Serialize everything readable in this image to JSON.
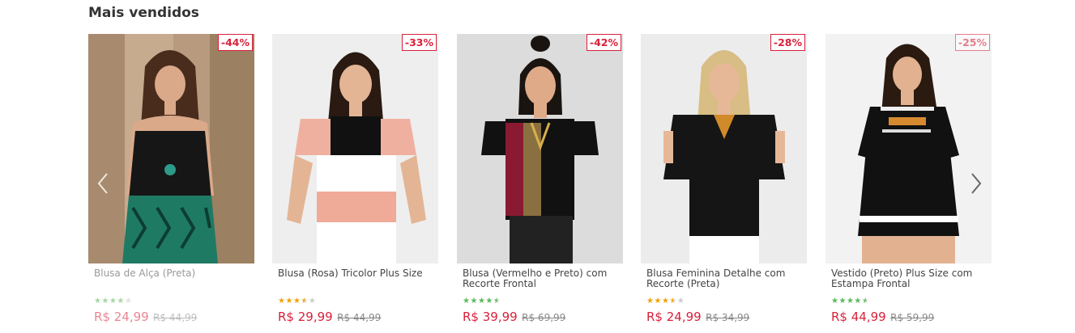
{
  "section": {
    "title": "Mais vendidos"
  },
  "nav": {
    "prev_icon": "chevron-left-icon",
    "next_icon": "chevron-right-icon"
  },
  "colors": {
    "accent": "#d9213a",
    "star_green": "#5cb85c",
    "star_gold": "#f0a30a",
    "star_empty": "#cccccc"
  },
  "products": [
    {
      "name": "Blusa de Alça (Preta)",
      "discount": "-44%",
      "price": "R$ 24,99",
      "old_price": "R$ 44,99",
      "rating": 4,
      "star_color": "green"
    },
    {
      "name": "Blusa (Rosa) Tricolor Plus Size",
      "discount": "-33%",
      "price": "R$ 29,99",
      "old_price": "R$ 44,99",
      "rating": 3.5,
      "star_color": "gold"
    },
    {
      "name": "Blusa (Vermelho e Preto) com Recorte Frontal",
      "discount": "-42%",
      "price": "R$ 39,99",
      "old_price": "R$ 69,99",
      "rating": 4.5,
      "star_color": "green"
    },
    {
      "name": "Blusa Feminina Detalhe com Recorte (Preta)",
      "discount": "-28%",
      "price": "R$ 24,99",
      "old_price": "R$ 34,99",
      "rating": 3.5,
      "star_color": "gold"
    },
    {
      "name": "Vestido (Preto) Plus Size com Estampa Frontal",
      "discount": "-25%",
      "price": "R$ 44,99",
      "old_price": "R$ 59,99",
      "rating": 4.5,
      "star_color": "green"
    }
  ]
}
